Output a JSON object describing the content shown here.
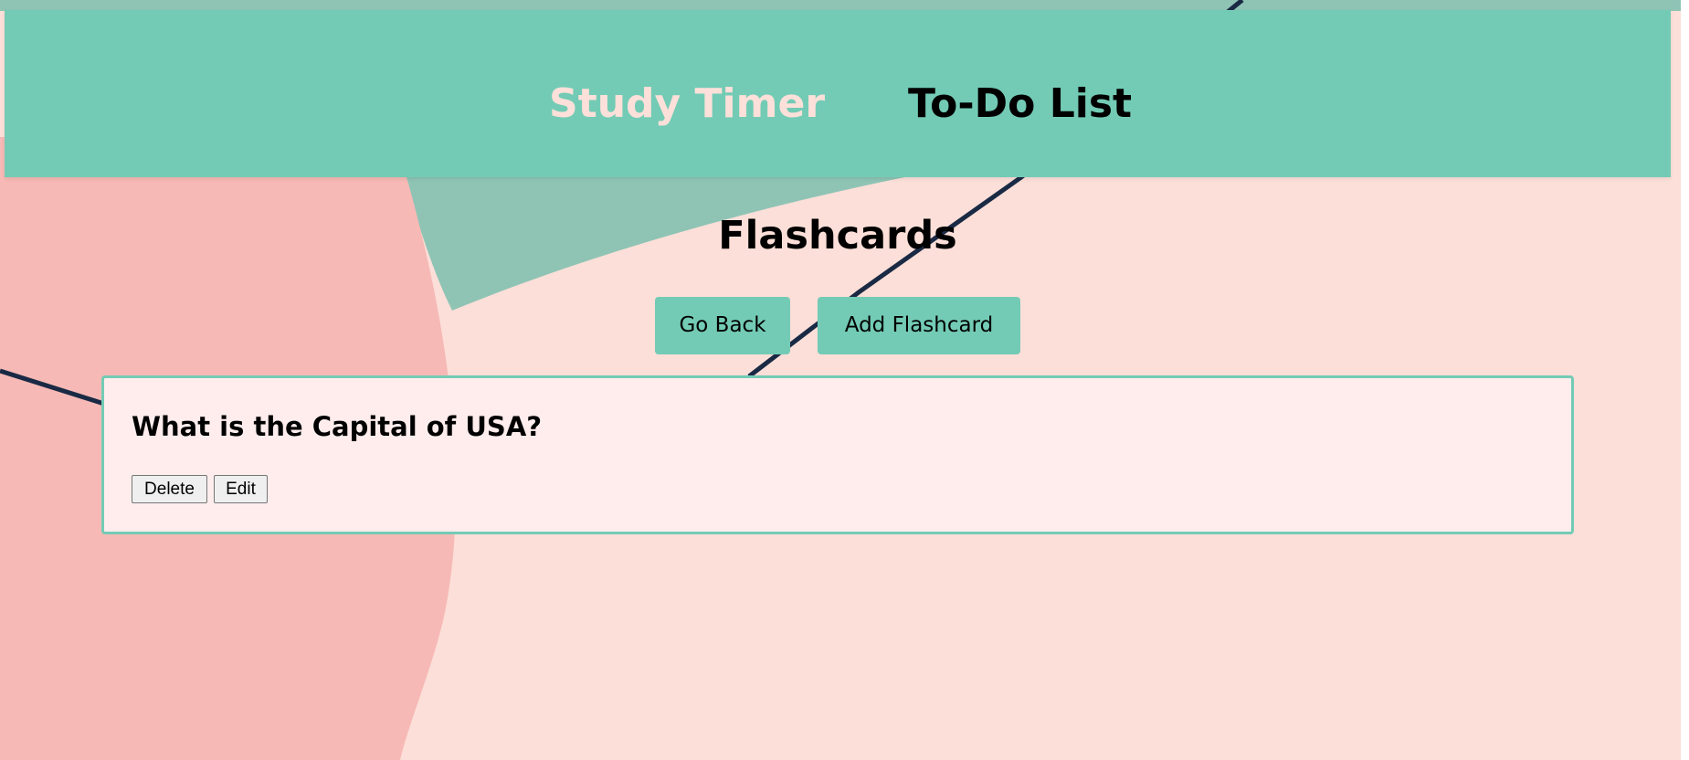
{
  "nav": {
    "study_timer_label": "Study Timer",
    "todo_label": "To-Do List"
  },
  "page": {
    "title": "Flashcards"
  },
  "actions": {
    "go_back_label": "Go Back",
    "add_flashcard_label": "Add Flashcard"
  },
  "flashcards": [
    {
      "question": "What is the Capital of USA?",
      "delete_label": "Delete",
      "edit_label": "Edit"
    }
  ],
  "colors": {
    "primary": "#73cbb5",
    "background": "#fcdfd8",
    "card_background": "#ffeded",
    "nav_active_text": "#fde0d9",
    "decorative_pink": "#f6b9b5",
    "decorative_teal": "#8fc4b5",
    "decorative_line": "#1a2a45"
  }
}
